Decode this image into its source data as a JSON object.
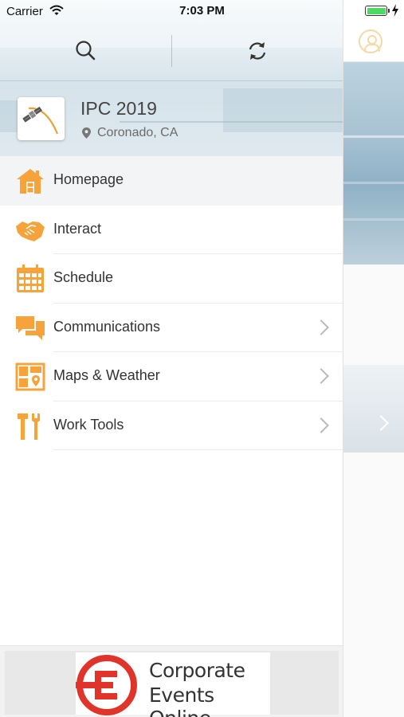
{
  "status_bar": {
    "carrier": "Carrier",
    "time": "7:03 PM",
    "battery_level": 1.0
  },
  "drawer": {
    "toolbar": {
      "search_icon": "search-icon",
      "refresh_icon": "refresh-icon"
    },
    "event": {
      "title": "IPC 2019",
      "location": "Coronado, CA",
      "location_icon": "location-pin-icon"
    },
    "menu": [
      {
        "label": "Homepage",
        "icon": "home-icon",
        "has_chevron": false,
        "active": true
      },
      {
        "label": "Interact",
        "icon": "handshake-icon",
        "has_chevron": false,
        "active": false
      },
      {
        "label": "Schedule",
        "icon": "calendar-icon",
        "has_chevron": false,
        "active": false
      },
      {
        "label": "Communications",
        "icon": "chat-bubbles-icon",
        "has_chevron": true,
        "active": false
      },
      {
        "label": "Maps & Weather",
        "icon": "map-icon",
        "has_chevron": true,
        "active": false
      },
      {
        "label": "Work Tools",
        "icon": "tools-icon",
        "has_chevron": true,
        "active": false
      }
    ],
    "sponsor": {
      "line1": "Corporate",
      "line2": "Events Online",
      "mark_icon": "corporate-events-online-logo"
    }
  },
  "main_peek": {
    "avatar_icon": "user-avatar-icon",
    "chevron_icon": "chevron-right-icon"
  },
  "colors": {
    "accent": "#f5a33a",
    "text": "#333333",
    "muted": "#6b6b6b",
    "sponsor_red": "#e0342a",
    "battery_green": "#4cd964"
  }
}
